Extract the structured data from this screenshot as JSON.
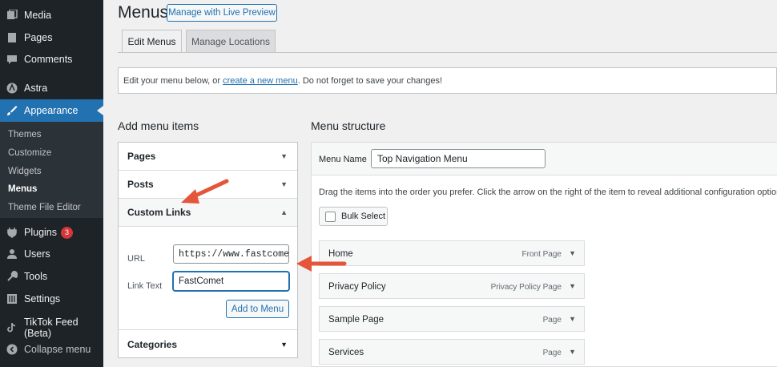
{
  "sidebar": {
    "items": [
      {
        "label": "Media",
        "icon": "media-icon"
      },
      {
        "label": "Pages",
        "icon": "pages-icon"
      },
      {
        "label": "Comments",
        "icon": "comments-icon"
      },
      {
        "label": "Astra",
        "icon": "astra-icon"
      },
      {
        "label": "Appearance",
        "icon": "paintbrush-icon"
      },
      {
        "label": "Plugins",
        "icon": "plugin-icon",
        "badge": "3"
      },
      {
        "label": "Users",
        "icon": "user-icon"
      },
      {
        "label": "Tools",
        "icon": "wrench-icon"
      },
      {
        "label": "Settings",
        "icon": "settings-icon"
      },
      {
        "label": "TikTok Feed (Beta)",
        "icon": "tiktok-icon"
      },
      {
        "label": "Collapse menu",
        "icon": "collapse-icon"
      }
    ],
    "submenu": [
      "Themes",
      "Customize",
      "Widgets",
      "Menus",
      "Theme File Editor"
    ]
  },
  "header": {
    "title": "Menus",
    "live_preview_label": "Manage with Live Preview"
  },
  "tabs": [
    "Edit Menus",
    "Manage Locations"
  ],
  "notice": {
    "before": "Edit your menu below, or ",
    "link": "create a new menu",
    "after": ". Do not forget to save your changes!"
  },
  "add_items": {
    "title": "Add menu items",
    "sections": [
      "Pages",
      "Posts",
      "Custom Links",
      "Categories"
    ],
    "url_label": "URL",
    "url_value": "https://www.fastcomet",
    "link_text_label": "Link Text",
    "link_text_value": "FastComet",
    "add_button": "Add to Menu"
  },
  "structure": {
    "title": "Menu structure",
    "menu_name_label": "Menu Name",
    "menu_name_value": "Top Navigation Menu",
    "instructions": "Drag the items into the order you prefer. Click the arrow on the right of the item to reveal additional configuration options.",
    "bulk_select": "Bulk Select",
    "items": [
      {
        "title": "Home",
        "type": "Front Page"
      },
      {
        "title": "Privacy Policy",
        "type": "Privacy Policy Page"
      },
      {
        "title": "Sample Page",
        "type": "Page"
      },
      {
        "title": "Services",
        "type": "Page"
      }
    ]
  },
  "colors": {
    "sidebar_bg": "#1d2327",
    "accent": "#2271b1",
    "annotation_arrow": "#e4553a",
    "badge": "#d63638"
  }
}
